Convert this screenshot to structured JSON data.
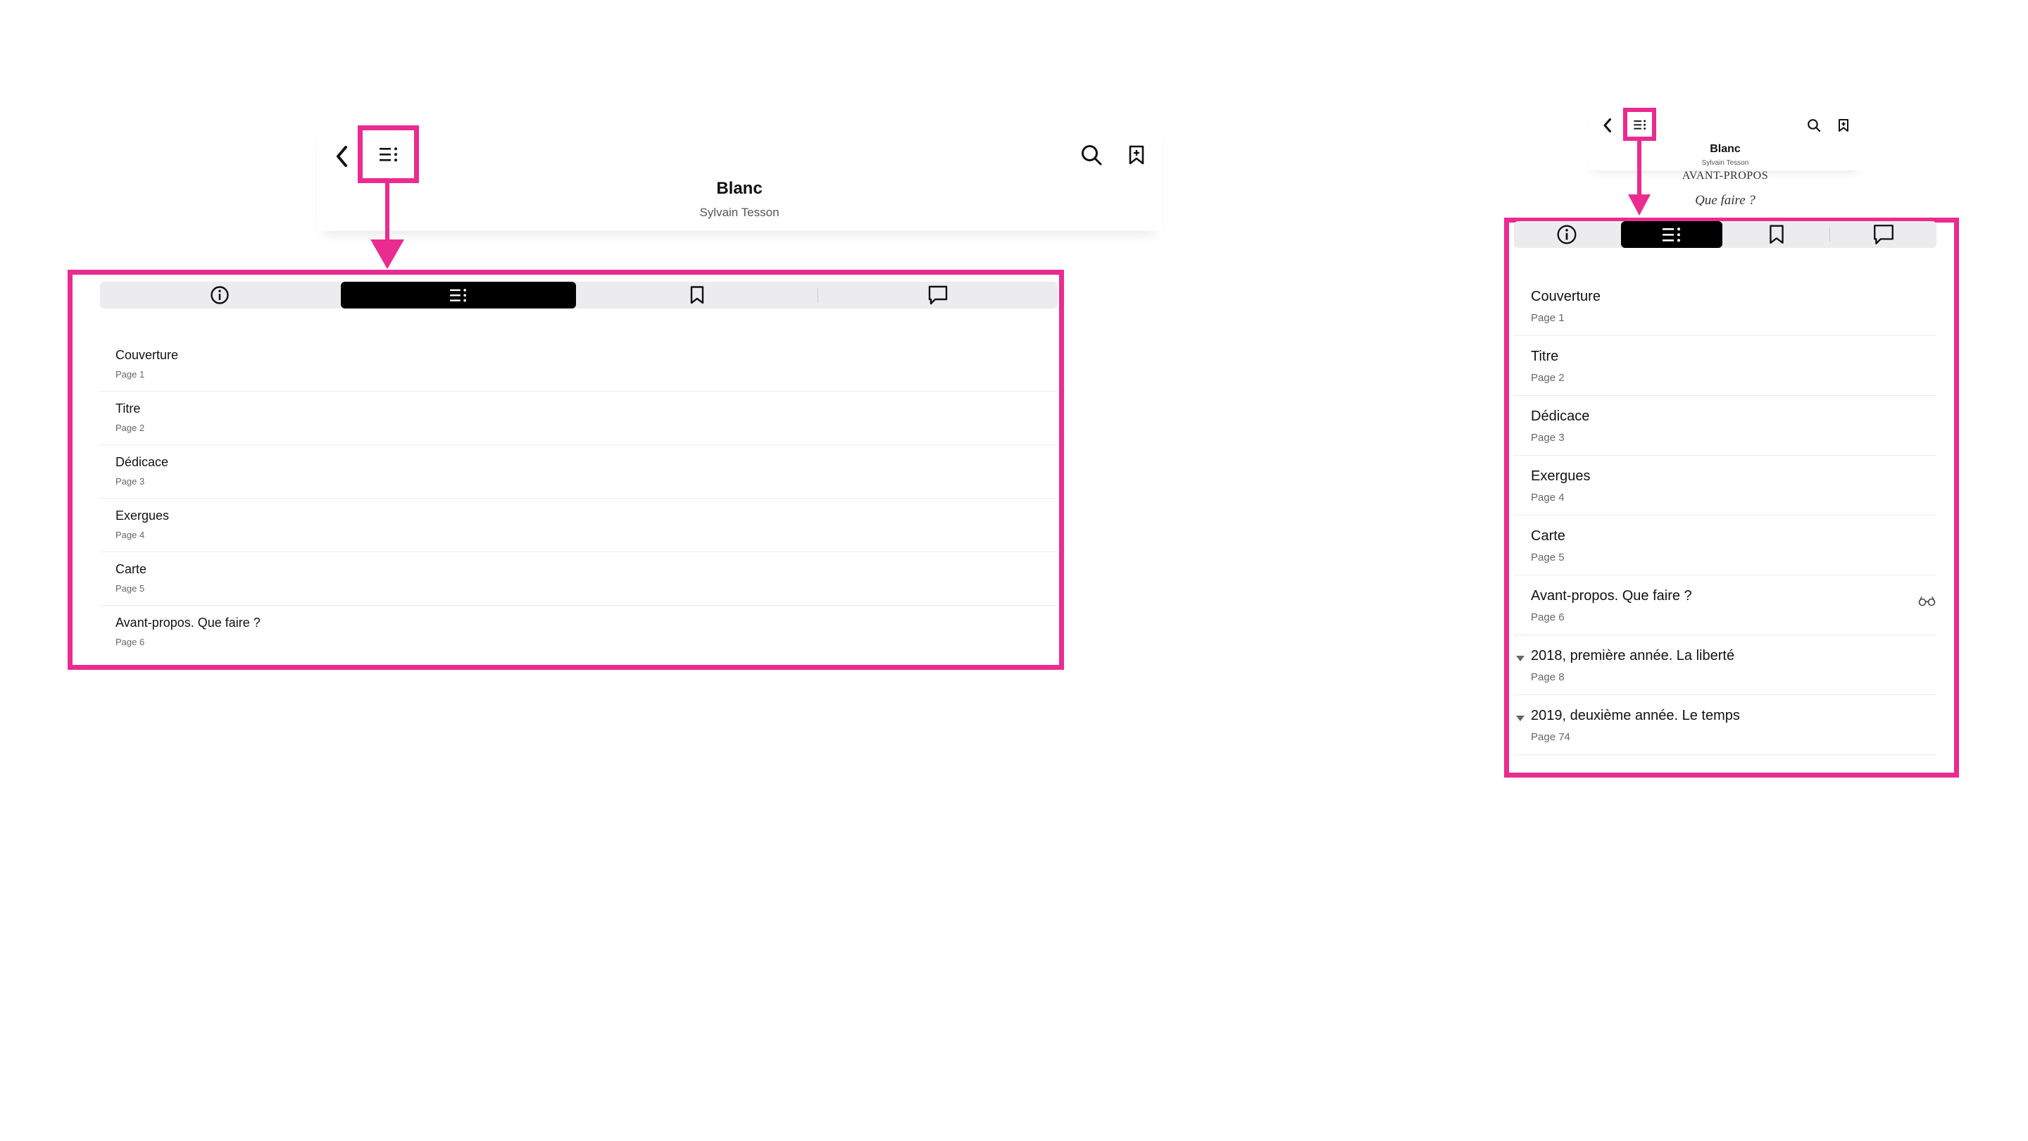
{
  "book": {
    "title": "Blanc",
    "author": "Sylvain Tesson"
  },
  "reader_preview": {
    "chapter_heading": "AVANT-PROPOS",
    "chapter_subtitle": "Que faire ?"
  },
  "tabs": [
    {
      "name": "info",
      "icon": "info-icon"
    },
    {
      "name": "contents",
      "icon": "contents-list-icon",
      "active": true
    },
    {
      "name": "bookmarks",
      "icon": "bookmark-icon"
    },
    {
      "name": "notes",
      "icon": "comment-icon"
    }
  ],
  "toc_left": [
    {
      "title": "Couverture",
      "page": "Page 1"
    },
    {
      "title": "Titre",
      "page": "Page 2"
    },
    {
      "title": "Dédicace",
      "page": "Page 3"
    },
    {
      "title": "Exergues",
      "page": "Page 4"
    },
    {
      "title": "Carte",
      "page": "Page 5"
    },
    {
      "title": "Avant-propos. Que faire ?",
      "page": "Page 6"
    }
  ],
  "toc_right": [
    {
      "title": "Couverture",
      "page": "Page 1"
    },
    {
      "title": "Titre",
      "page": "Page 2"
    },
    {
      "title": "Dédicace",
      "page": "Page 3"
    },
    {
      "title": "Exergues",
      "page": "Page 4"
    },
    {
      "title": "Carte",
      "page": "Page 5"
    },
    {
      "title": "Avant-propos. Que faire ?",
      "page": "Page 6",
      "current": true,
      "icon": "reading-glasses-icon"
    },
    {
      "title": "2018, première année. La liberté",
      "page": "Page 8",
      "expandable": true
    },
    {
      "title": "2019, deuxième année. Le temps",
      "page": "Page 74",
      "expandable": true
    }
  ],
  "colors": {
    "highlight": "#ea2b8f",
    "segment_bg": "#ececee",
    "segment_active": "#000000"
  }
}
